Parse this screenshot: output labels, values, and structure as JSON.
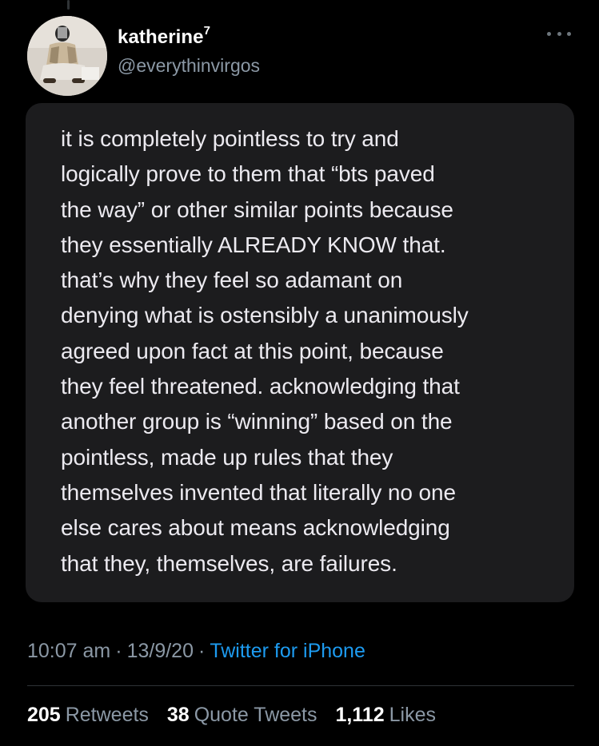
{
  "author": {
    "display_name": "katherine",
    "name_suffix": "7",
    "handle": "@everythinvirgos"
  },
  "tweet": {
    "image_text_lines": [
      "it is completely pointless to try and",
      "logically prove to them that “bts paved",
      "the way” or other similar points because",
      "they essentially ALREADY KNOW that.",
      "that’s why they feel so adamant on",
      "denying what is ostensibly a unanimously",
      "agreed upon fact at this point, because",
      "they feel threatened. acknowledging that",
      "another group is “winning” based on the",
      "pointless, made up rules that they",
      "themselves invented that literally no one",
      "else cares about means acknowledging",
      "that they, themselves, are failures."
    ]
  },
  "meta": {
    "time": "10:07 am",
    "date": "13/9/20",
    "separator": "·",
    "source": "Twitter for iPhone"
  },
  "stats": {
    "retweets": {
      "count": "205",
      "label": "Retweets"
    },
    "quote_tweets": {
      "count": "38",
      "label": "Quote Tweets"
    },
    "likes": {
      "count": "1,112",
      "label": "Likes"
    }
  },
  "icons": {
    "more": "more-horizontal-icon"
  },
  "colors": {
    "background": "#000000",
    "link": "#1d9bf0",
    "secondary_text": "#8b98a5",
    "note_card": "#1c1c1e"
  }
}
